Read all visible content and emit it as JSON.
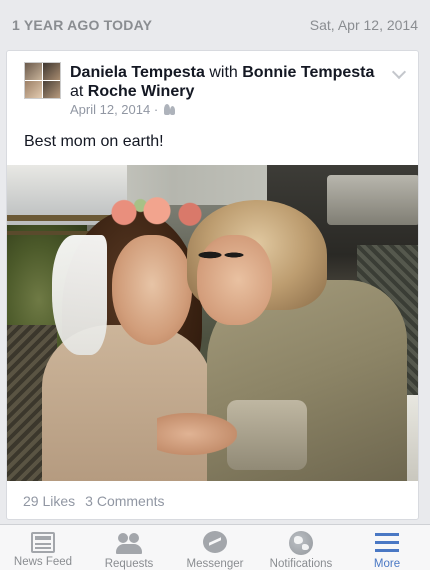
{
  "memory": {
    "label": "1 YEAR AGO TODAY",
    "date": "Sat, Apr 12, 2014"
  },
  "post": {
    "author": "Daniela Tempesta",
    "with_word": "with",
    "tagged": "Bonnie Tempesta",
    "at_word": "at",
    "place": "Roche Winery",
    "date": "April 12, 2014 ·",
    "privacy_icon": "friends-icon",
    "text": "Best mom on earth!",
    "likes": "29 Likes",
    "comments": "3 Comments"
  },
  "tabs": [
    {
      "label": "News Feed",
      "icon": "newsfeed-icon"
    },
    {
      "label": "Requests",
      "icon": "requests-icon"
    },
    {
      "label": "Messenger",
      "icon": "messenger-icon"
    },
    {
      "label": "Notifications",
      "icon": "globe-icon"
    },
    {
      "label": "More",
      "icon": "menu-icon",
      "active": true
    }
  ],
  "colors": {
    "accent": "#4a78c4",
    "background": "#e9eaed",
    "meta_text": "#9197a3"
  }
}
